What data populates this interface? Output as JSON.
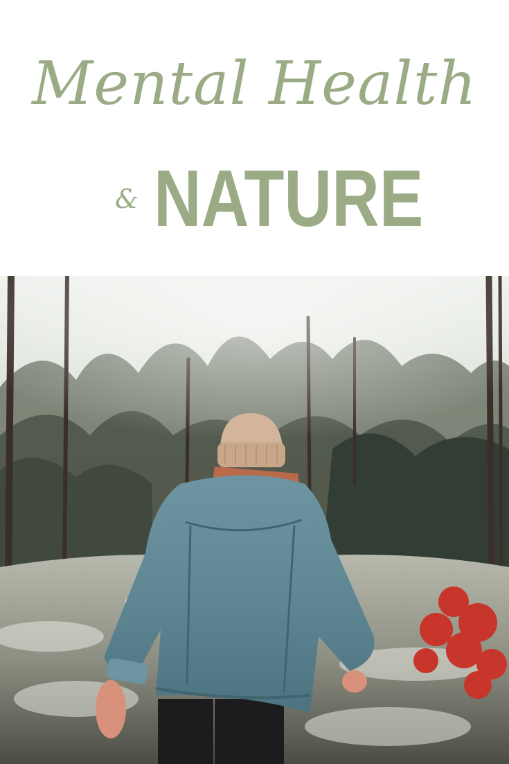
{
  "header": {
    "script_title": "Mental Health",
    "ampersand": "&",
    "block_title": "NATURE"
  },
  "colors": {
    "title_green": "#9aab85",
    "background": "#ffffff"
  },
  "photo": {
    "subject": "woman-in-forest"
  }
}
